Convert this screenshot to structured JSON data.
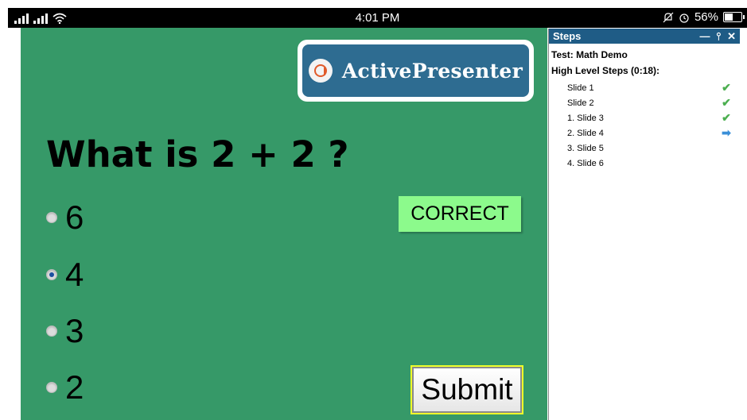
{
  "status_bar": {
    "time": "4:01 PM",
    "battery": "56%",
    "battery_level": 0.56
  },
  "slide": {
    "logo_text": "ActivePresenter",
    "question": "What is 2 + 2 ?",
    "options": [
      {
        "label": "6",
        "selected": false
      },
      {
        "label": "4",
        "selected": true
      },
      {
        "label": "3",
        "selected": false
      },
      {
        "label": "2",
        "selected": false
      }
    ],
    "feedback": "CORRECT",
    "submit_label": "Submit"
  },
  "steps_panel": {
    "title": "Steps",
    "test_name": "Test: Math Demo",
    "high_level": "High Level Steps (0:18):",
    "items": [
      {
        "label": "Slide 1",
        "status": "done"
      },
      {
        "label": "Slide 2",
        "status": "done"
      },
      {
        "label": "1. Slide 3",
        "status": "done"
      },
      {
        "label": "2. Slide 4",
        "status": "current"
      },
      {
        "label": "3. Slide 5",
        "status": ""
      },
      {
        "label": "4. Slide 6",
        "status": ""
      }
    ]
  },
  "colors": {
    "slide_bg": "#369968",
    "correct_bg": "#8cfa8c",
    "panel_header": "#1f5c86",
    "logo_bg": "#2e6c91"
  }
}
